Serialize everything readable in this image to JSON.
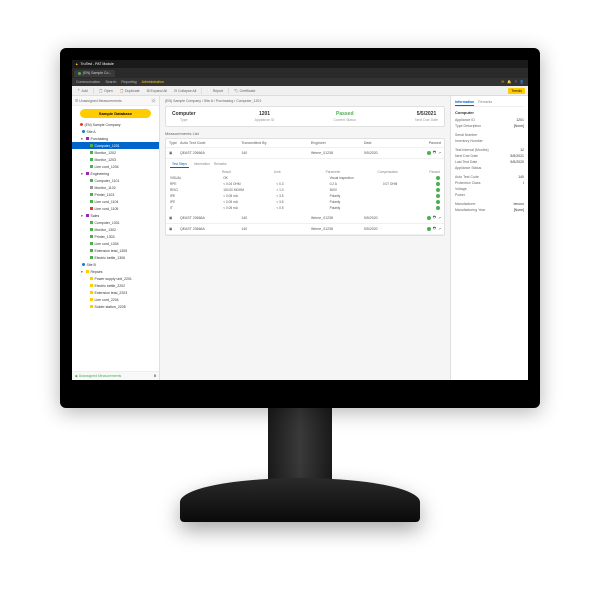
{
  "titlebar": {
    "app": "TruTest - PAT Module"
  },
  "tab": {
    "title": "(EN) Sample Co...",
    "sub": "EN"
  },
  "menu": {
    "items": [
      "Communication",
      "Search",
      "Reporting",
      "Administration"
    ]
  },
  "toolbar": {
    "add": "Add",
    "open": "Open",
    "dup": "Duplicate",
    "expand": "Expand All",
    "collapse": "Collapse All",
    "report": "Report",
    "cert": "Certificate",
    "trend": "Trends"
  },
  "sidebar": {
    "unassigned": "Unassigned Measurements",
    "unassigned_count": "0",
    "db_label": "Sample Database",
    "tree": [
      {
        "lvl": 0,
        "ico": "cust",
        "label": "(EN) Sample Company"
      },
      {
        "lvl": 1,
        "ico": "site",
        "label": "Site A"
      },
      {
        "lvl": 2,
        "ico": "loc",
        "label": "Purchasing",
        "exp": true
      },
      {
        "lvl": 3,
        "ico": "app-g",
        "label": "Computer_1201",
        "sel": true
      },
      {
        "lvl": 3,
        "ico": "app-g",
        "label": "Monitor_1202"
      },
      {
        "lvl": 3,
        "ico": "app-g",
        "label": "Monitor_1203"
      },
      {
        "lvl": 3,
        "ico": "app-g",
        "label": "Line cord_1204"
      },
      {
        "lvl": 2,
        "ico": "loc",
        "label": "Engineering",
        "exp": true
      },
      {
        "lvl": 3,
        "ico": "app-g",
        "label": "Computer_1101"
      },
      {
        "lvl": 3,
        "ico": "app-gr",
        "label": "Monitor_1102"
      },
      {
        "lvl": 3,
        "ico": "app-g",
        "label": "Printer_1103"
      },
      {
        "lvl": 3,
        "ico": "app-g",
        "label": "Line cord_1104"
      },
      {
        "lvl": 3,
        "ico": "app-r",
        "label": "Line cord_1105"
      },
      {
        "lvl": 2,
        "ico": "loc",
        "label": "Sales",
        "exp": true
      },
      {
        "lvl": 3,
        "ico": "app-g",
        "label": "Computer_1301"
      },
      {
        "lvl": 3,
        "ico": "app-g",
        "label": "Monitor_1302"
      },
      {
        "lvl": 3,
        "ico": "app-g",
        "label": "Printer_1303"
      },
      {
        "lvl": 3,
        "ico": "app-g",
        "label": "Line cord_1304"
      },
      {
        "lvl": 3,
        "ico": "app-g",
        "label": "Extension lead_1305"
      },
      {
        "lvl": 3,
        "ico": "app-g",
        "label": "Electric kettle_1306"
      },
      {
        "lvl": 1,
        "ico": "site",
        "label": "Site B"
      },
      {
        "lvl": 2,
        "ico": "fold",
        "label": "Repairs",
        "exp": true
      },
      {
        "lvl": 3,
        "ico": "app-y",
        "label": "Power supply unit_2201"
      },
      {
        "lvl": 3,
        "ico": "app-y",
        "label": "Electric kettle_2202"
      },
      {
        "lvl": 3,
        "ico": "app-y",
        "label": "Extension lead_2203"
      },
      {
        "lvl": 3,
        "ico": "app-y",
        "label": "Line cord_2204"
      },
      {
        "lvl": 3,
        "ico": "app-y",
        "label": "Solder station_2205"
      }
    ],
    "footer_label": "Unassigned Measurements",
    "footer_count": "0"
  },
  "crumb": "(EN) Sample Company  /  Site A  /  Purchasing  /  Computer_1201",
  "card": {
    "c1_val": "Computer",
    "c1_lbl": "Type",
    "c2_val": "1201",
    "c2_lbl": "Appliance ID",
    "c3_val": "Passed",
    "c3_lbl": "Current Status",
    "c4_val": "5/5/2021",
    "c4_lbl": "Next Due Date"
  },
  "list_title": "Measurements List",
  "list": {
    "hdr": {
      "type": "Type",
      "atc": "Auto Test Code",
      "by": "Transmitted By",
      "eng": "Engineer",
      "date": "Date",
      "pass": "Passed"
    },
    "rows": [
      {
        "type": "▣",
        "atc": "QEAST 20666A",
        "by": "140",
        "eng": "Werne_01238",
        "date": "5/5/2020"
      },
      {
        "type": "▣",
        "atc": "QEAST 20666A",
        "by": "140",
        "eng": "Werne_01238",
        "date": "5/5/2020"
      },
      {
        "type": "▣",
        "atc": "QEAST 20666A",
        "by": "140",
        "eng": "Werne_01238",
        "date": "5/5/2020"
      }
    ]
  },
  "exp": {
    "tab1": "Test Steps",
    "tab2": "Information",
    "tab3": "Remarks",
    "hdr": {
      "n": "",
      "r": "Result",
      "l": "Limit",
      "p": "Parameter",
      "c": "Compensation",
      "ps": "Passed"
    },
    "rows": [
      {
        "n": "VISUAL",
        "r": "OK",
        "l": "",
        "p": "Visual Inspection",
        "c": ""
      },
      {
        "n": "RPE",
        "r": "< 0.04 OHM",
        "l": "< 0.3",
        "p": "0.2 A",
        "c": "0.07 OHM"
      },
      {
        "n": "RISO",
        "r": "100.00 MOHM",
        "l": "> 1.0",
        "p": "500V",
        "c": ""
      },
      {
        "n": "IPE",
        "r": "< 0.05 mA",
        "l": "< 3.5",
        "p": "Polarity",
        "c": ""
      },
      {
        "n": "IPE",
        "r": "< 0.05 mA",
        "l": "< 3.5",
        "p": "Polarity",
        "c": ""
      },
      {
        "n": "IT",
        "r": "< 0.05 mA",
        "l": "< 0.5",
        "p": "Polarity",
        "c": ""
      }
    ]
  },
  "info": {
    "tab_info": "Information",
    "tab_rem": "Remarks",
    "sec1": "Computer",
    "app_id_l": "Appliance ID",
    "app_id_v": "1201",
    "type_l": "Type Description",
    "type_v": "[None]",
    "sn_l": "Serial Number",
    "sn_v": "",
    "inv_l": "Inventory Number",
    "inv_v": "",
    "ti_l": "Test Interval (Months)",
    "ti_v": "12",
    "ndd_l": "Next Due Date",
    "ndd_v": "5/5/2021",
    "ltd_l": "Last Test Date",
    "ltd_v": "5/5/2020",
    "as_l": "Appliance Status",
    "as_v": "",
    "atc_l": "Auto Test Code",
    "atc_v": "140",
    "pc_l": "Protection Class",
    "pc_v": "I",
    "volt_l": "Voltage",
    "volt_v": "",
    "pow_l": "Power",
    "pow_v": "",
    "mfr_l": "Manufacturer",
    "mfr_v": "lenovo",
    "my_l": "Manufacturing Year",
    "my_v": "[None]"
  }
}
